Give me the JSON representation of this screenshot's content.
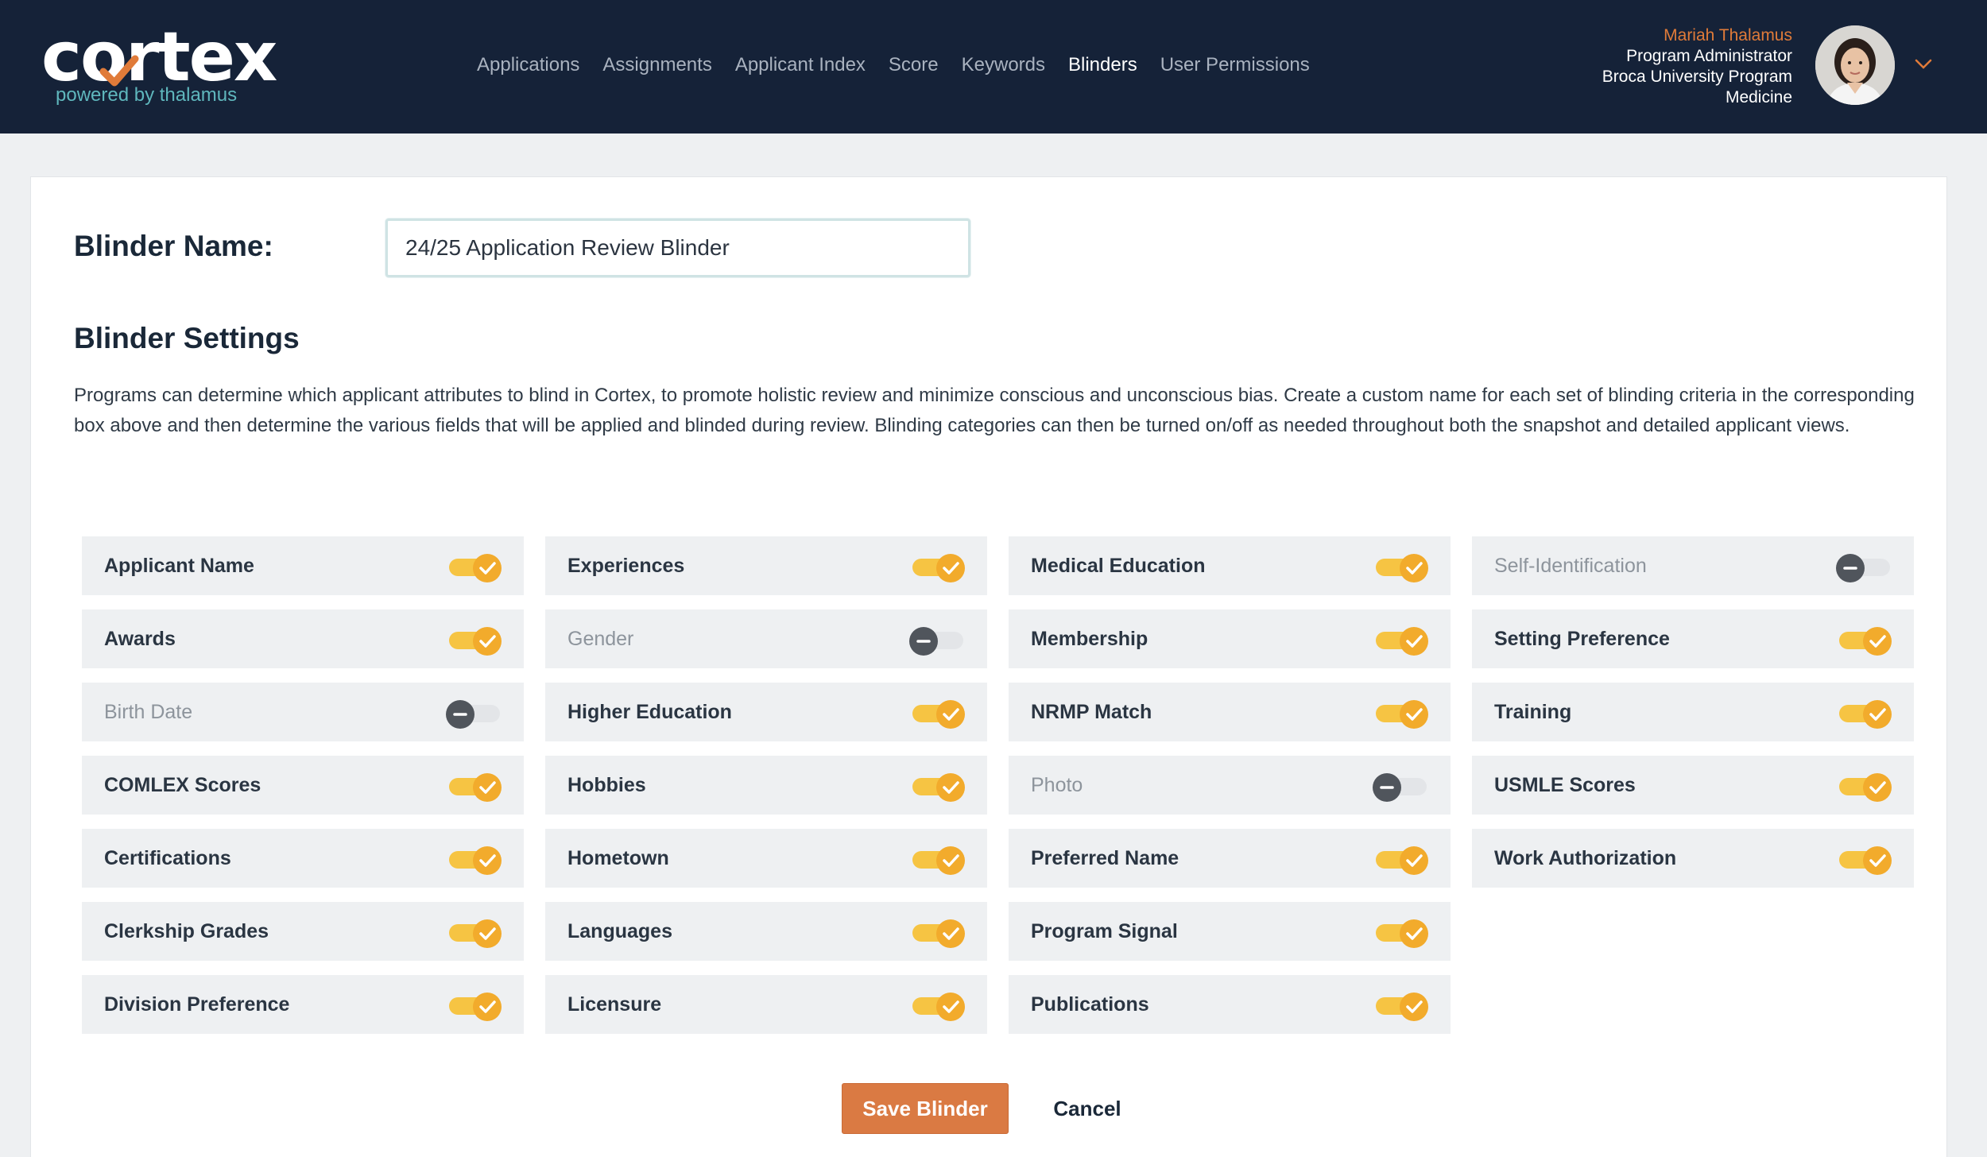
{
  "brand": {
    "name": "cortex",
    "tagline": "powered by thalamus",
    "accent_color": "#e07b39",
    "teal_color": "#5fb7bd"
  },
  "nav": {
    "items": [
      {
        "label": "Applications",
        "active": false
      },
      {
        "label": "Assignments",
        "active": false
      },
      {
        "label": "Applicant Index",
        "active": false
      },
      {
        "label": "Score",
        "active": false
      },
      {
        "label": "Keywords",
        "active": false
      },
      {
        "label": "Blinders",
        "active": true
      },
      {
        "label": "User Permissions",
        "active": false
      }
    ]
  },
  "user": {
    "name": "Mariah Thalamus",
    "role": "Program Administrator",
    "program_line1": "Broca University Program",
    "program_line2": "Medicine"
  },
  "form": {
    "name_label": "Blinder Name:",
    "name_value": "24/25 Application Review Blinder",
    "settings_title": "Blinder Settings",
    "description": "Programs can determine which applicant attributes to blind in Cortex, to promote holistic review and minimize conscious and unconscious bias. Create a custom name for each set of blinding criteria in the corresponding box above and then determine the various fields that will be applied and blinded during review. Blinding categories can then be turned on/off as needed throughout both the snapshot and detailed applicant views."
  },
  "categories": [
    {
      "label": "Applicant Name",
      "enabled": true
    },
    {
      "label": "Awards",
      "enabled": true
    },
    {
      "label": "Birth Date",
      "enabled": false
    },
    {
      "label": "COMLEX Scores",
      "enabled": true
    },
    {
      "label": "Certifications",
      "enabled": true
    },
    {
      "label": "Clerkship Grades",
      "enabled": true
    },
    {
      "label": "Division Preference",
      "enabled": true
    },
    {
      "label": "Experiences",
      "enabled": true
    },
    {
      "label": "Gender",
      "enabled": false
    },
    {
      "label": "Higher Education",
      "enabled": true
    },
    {
      "label": "Hobbies",
      "enabled": true
    },
    {
      "label": "Hometown",
      "enabled": true
    },
    {
      "label": "Languages",
      "enabled": true
    },
    {
      "label": "Licensure",
      "enabled": true
    },
    {
      "label": "Medical Education",
      "enabled": true
    },
    {
      "label": "Membership",
      "enabled": true
    },
    {
      "label": "NRMP Match",
      "enabled": true
    },
    {
      "label": "Photo",
      "enabled": false
    },
    {
      "label": "Preferred Name",
      "enabled": true
    },
    {
      "label": "Program Signal",
      "enabled": true
    },
    {
      "label": "Publications",
      "enabled": true
    },
    {
      "label": "Self-Identification",
      "enabled": false
    },
    {
      "label": "Setting Preference",
      "enabled": true
    },
    {
      "label": "Training",
      "enabled": true
    },
    {
      "label": "USMLE Scores",
      "enabled": true
    },
    {
      "label": "Work Authorization",
      "enabled": true
    }
  ],
  "actions": {
    "save_label": "Save Blinder",
    "cancel_label": "Cancel"
  },
  "icons": {
    "toggle_on": "checkmark-icon",
    "toggle_off": "minus-icon",
    "user_menu": "chevron-down-icon"
  }
}
